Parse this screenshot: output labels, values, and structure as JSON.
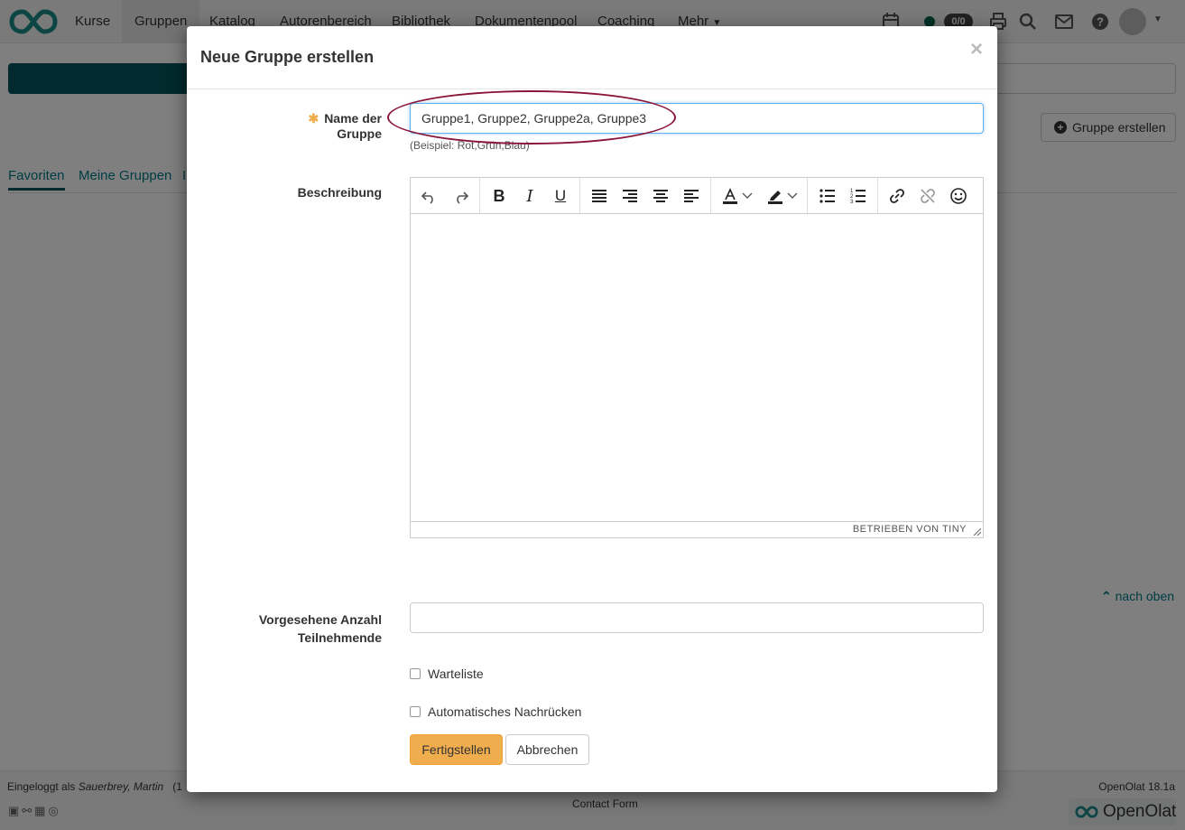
{
  "nav": {
    "items": [
      "Kurse",
      "Gruppen",
      "Katalog",
      "Autorenbereich",
      "Bibliothek",
      "Dokumentenpool",
      "Coaching",
      "Mehr"
    ],
    "active": "Gruppen",
    "badge": "0/0"
  },
  "background": {
    "create_group_button": "Gruppe erstellen",
    "tabs": [
      "Favoriten",
      "Meine Gruppen",
      "I"
    ],
    "back_to_top": "nach oben"
  },
  "footer": {
    "login_prefix": "Eingeloggt als",
    "login_user": "Sauerbrey, Martin",
    "login_suffix": "(1",
    "version": "OpenOlat 18.1a",
    "contact": "Contact Form",
    "brand": "OpenOlat"
  },
  "modal": {
    "title": "Neue Gruppe erstellen",
    "close": "×",
    "name_label": "Name der Gruppe",
    "required_marker": "✱",
    "name_value": "Gruppe1, Gruppe2, Gruppe2a, Gruppe3",
    "name_hint": "(Beispiel: Rot,Grün,Blau)",
    "description_label": "Beschreibung",
    "editor_status": "BETRIEBEN VON TINY",
    "participants_label_line1": "Vorgesehene Anzahl",
    "participants_label_line2": "Teilnehmende",
    "participants_value": "",
    "waitlist_label": "Warteliste",
    "autofill_label": "Automatisches Nachrücken",
    "submit_label": "Fertigstellen",
    "cancel_label": "Abbrechen"
  },
  "colors": {
    "brand_teal": "#00555a",
    "link_teal": "#007a87",
    "primary_button": "#f0ad4e",
    "annotation": "#8b1538",
    "focus_border": "#66afe9"
  }
}
